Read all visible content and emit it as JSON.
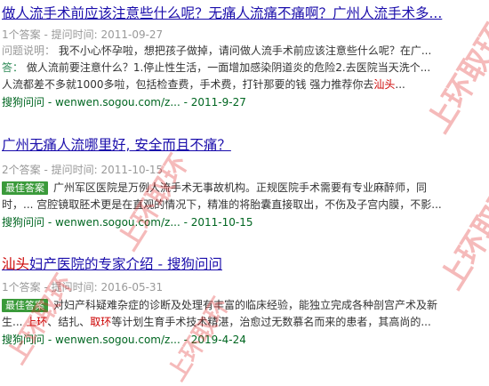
{
  "results": [
    {
      "title": "做人流手术前应该注意些什么呢？无痛人流痛不痛啊？广州人流手术多...",
      "meta": "1个答案 - 提问时间: 2011-09-27",
      "question_label": "问题说明：",
      "question_text": "我不小心怀孕啦，想把孩子做掉，请问做人流手术前应该注意些什么呢？在广...",
      "answer_label": "答：",
      "answer_line1": "做人流前要注意什么？1.停止性生活，一面增加感染阴道炎的危险2.去医院当天洗个...",
      "answer_line2_pre": "人流都差不多就1000多啦，包括检查费，手术费，打针那要的钱 强力推荐你去",
      "answer_line2_hl": "汕头",
      "answer_line2_post": "...",
      "source_pre": "搜狗问问 - wenwen.sogou.com/z...",
      "source_date": " - 2011-9-27"
    },
    {
      "title": "广州无痛人流哪里好, 安全而且不痛？",
      "meta": "2个答案 - 提问时间: 2011-10-15",
      "best_label": "最佳答案",
      "answer_line1": "广州军区医院是万例人流手术无事故机构。正规医院手术需要有专业麻醉师，同",
      "answer_line2": "时，... 宫腔镜取胚术更是在直观的情况下，精准的将胎囊直接取出，不伤及子宫内膜，不影...",
      "source_pre": "搜狗问问 - wenwen.sogou.com/z...",
      "source_date": " - 2011-10-15"
    },
    {
      "title_hl": "汕头",
      "title_rest": "妇产医院的专家介绍 - 搜狗问问",
      "meta": "1个答案 - 提问时间: 2016-05-31",
      "best_label": "最佳答案",
      "answer_line1": "对妇产科疑难杂症的诊断及处理有丰富的临床经验，能独立完成各种剖宫产术及新",
      "answer_line2_a": "生... ",
      "answer_line2_hl1": "上环",
      "answer_line2_b": "、结扎、",
      "answer_line2_hl2": "取环",
      "answer_line2_c": "等计划生育手术技术精湛，治愈过无数慕名而来的患者，其高尚的...",
      "source_pre": "搜狗问问 - wenwen.sogou.com/z...",
      "source_date": " - 2019-4-24"
    }
  ],
  "watermark": {
    "text": "上环取环",
    "color": "#e12828"
  }
}
